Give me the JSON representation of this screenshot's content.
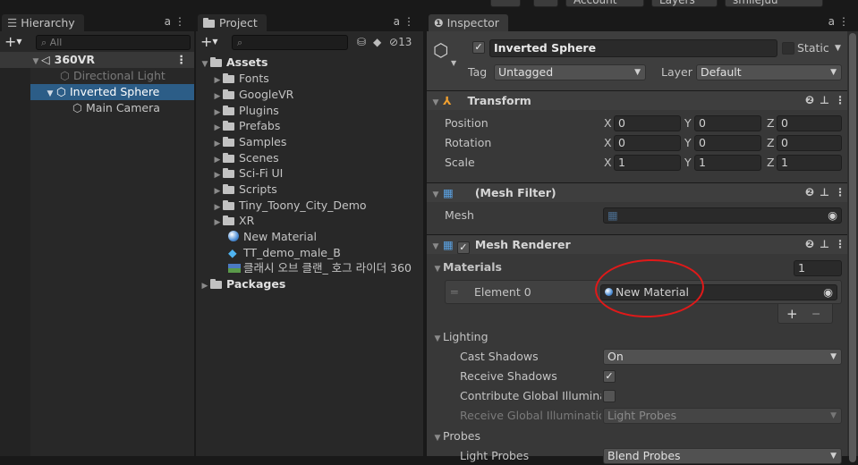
{
  "top_bar": {
    "buttons": [
      "Account",
      "Layers",
      "smilejuu"
    ]
  },
  "hierarchy": {
    "tab_label": "Hierarchy",
    "search_placeholder": "All",
    "scene_name": "360VR",
    "items": [
      "Directional Light",
      "Inverted Sphere",
      "Main Camera"
    ],
    "selected_item": "Inverted Sphere"
  },
  "project": {
    "tab_label": "Project",
    "hidden_count": "13",
    "root": "Assets",
    "folders": [
      "Fonts",
      "GoogleVR",
      "Plugins",
      "Prefabs",
      "Samples",
      "Scenes",
      "Sci-Fi UI",
      "Scripts",
      "Tiny_Toony_City_Demo",
      "XR"
    ],
    "assets": [
      "New Material",
      "TT_demo_male_B",
      "클래시 오브 클랜_ 호그 라이더 360"
    ],
    "packages": "Packages"
  },
  "inspector": {
    "tab_label": "Inspector",
    "object_name": "Inverted Sphere",
    "static_label": "Static",
    "tag_label": "Tag",
    "tag_value": "Untagged",
    "layer_label": "Layer",
    "layer_value": "Default",
    "transform": {
      "title": "Transform",
      "rows": [
        {
          "label": "Position",
          "x": "0",
          "y": "0",
          "z": "0"
        },
        {
          "label": "Rotation",
          "x": "0",
          "y": "0",
          "z": "0"
        },
        {
          "label": "Scale",
          "x": "1",
          "y": "1",
          "z": "1"
        }
      ],
      "axis_x": "X",
      "axis_y": "Y",
      "axis_z": "Z"
    },
    "mesh_filter": {
      "title": "(Mesh Filter)",
      "mesh_label": "Mesh"
    },
    "mesh_renderer": {
      "title": "Mesh Renderer",
      "materials_label": "Materials",
      "materials_count": "1",
      "element_label": "Element 0",
      "element_value": "New Material",
      "add_label": "+",
      "remove_label": "−",
      "lighting_label": "Lighting",
      "cast_shadows_label": "Cast Shadows",
      "cast_shadows_value": "On",
      "receive_shadows_label": "Receive Shadows",
      "contribute_gi_label": "Contribute Global Illumina",
      "receive_gi_label": "Receive Global Illuminatic",
      "receive_gi_value": "Light Probes",
      "probes_label": "Probes",
      "light_probes_label": "Light Probes",
      "light_probes_value": "Blend Probes"
    }
  },
  "colors": {
    "selection": "#2c5d87",
    "annotation": "#e01919",
    "panel_bg": "#282828"
  }
}
